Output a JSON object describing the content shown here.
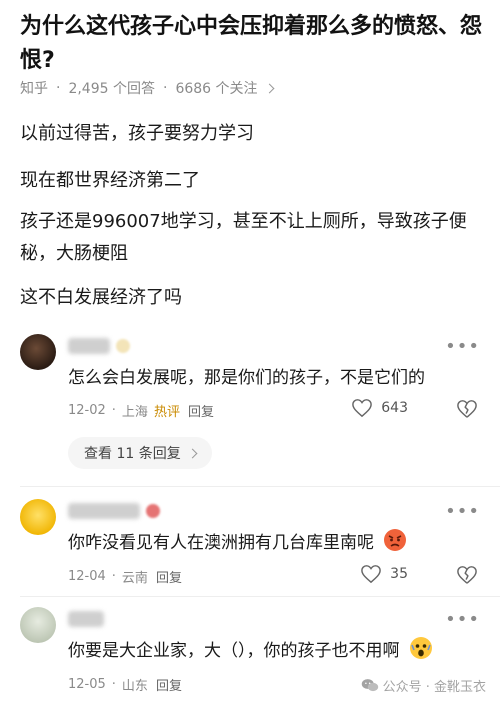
{
  "question": {
    "title": "为什么这代孩子心中会压抑着那么多的愤怒、怨恨?",
    "source": "知乎",
    "answers": "2,495 个回答",
    "followers": "6686 个关注"
  },
  "answer": {
    "paragraphs": [
      "以前过得苦，孩子要努力学习",
      "现在都世界经济第二了",
      "孩子还是996007地学习，甚至不让上厕所，导致孩子便秘，大肠梗阻",
      "这不白发展经济了吗"
    ]
  },
  "comments": [
    {
      "text": "怎么会白发展呢，那是你们的孩子，不是它们的",
      "date": "12-02",
      "location": "上海",
      "badge": "热评",
      "reply_label": "回复",
      "likes": "643",
      "avatar_color": "#3a2a20"
    },
    {
      "text": "你咋没看见有人在澳洲拥有几台库里南呢",
      "date": "12-04",
      "location": "云南",
      "reply_label": "回复",
      "likes": "35",
      "avatar_color": "#f2c230"
    },
    {
      "text": "你要是大企业家，大（），你的孩子也不用啊",
      "date": "12-05",
      "location": "山东",
      "reply_label": "回复",
      "avatar_color": "#cfd6c8"
    }
  ],
  "view_replies": "查看 11 条回复",
  "watermark": "公众号 · 金靴玉衣",
  "icons": {
    "more": "more-horizontal-icon",
    "like": "heart-icon",
    "dislike": "broken-heart-icon",
    "angry_emoji": "angry-face-icon",
    "shocked_emoji": "shocked-face-icon"
  }
}
